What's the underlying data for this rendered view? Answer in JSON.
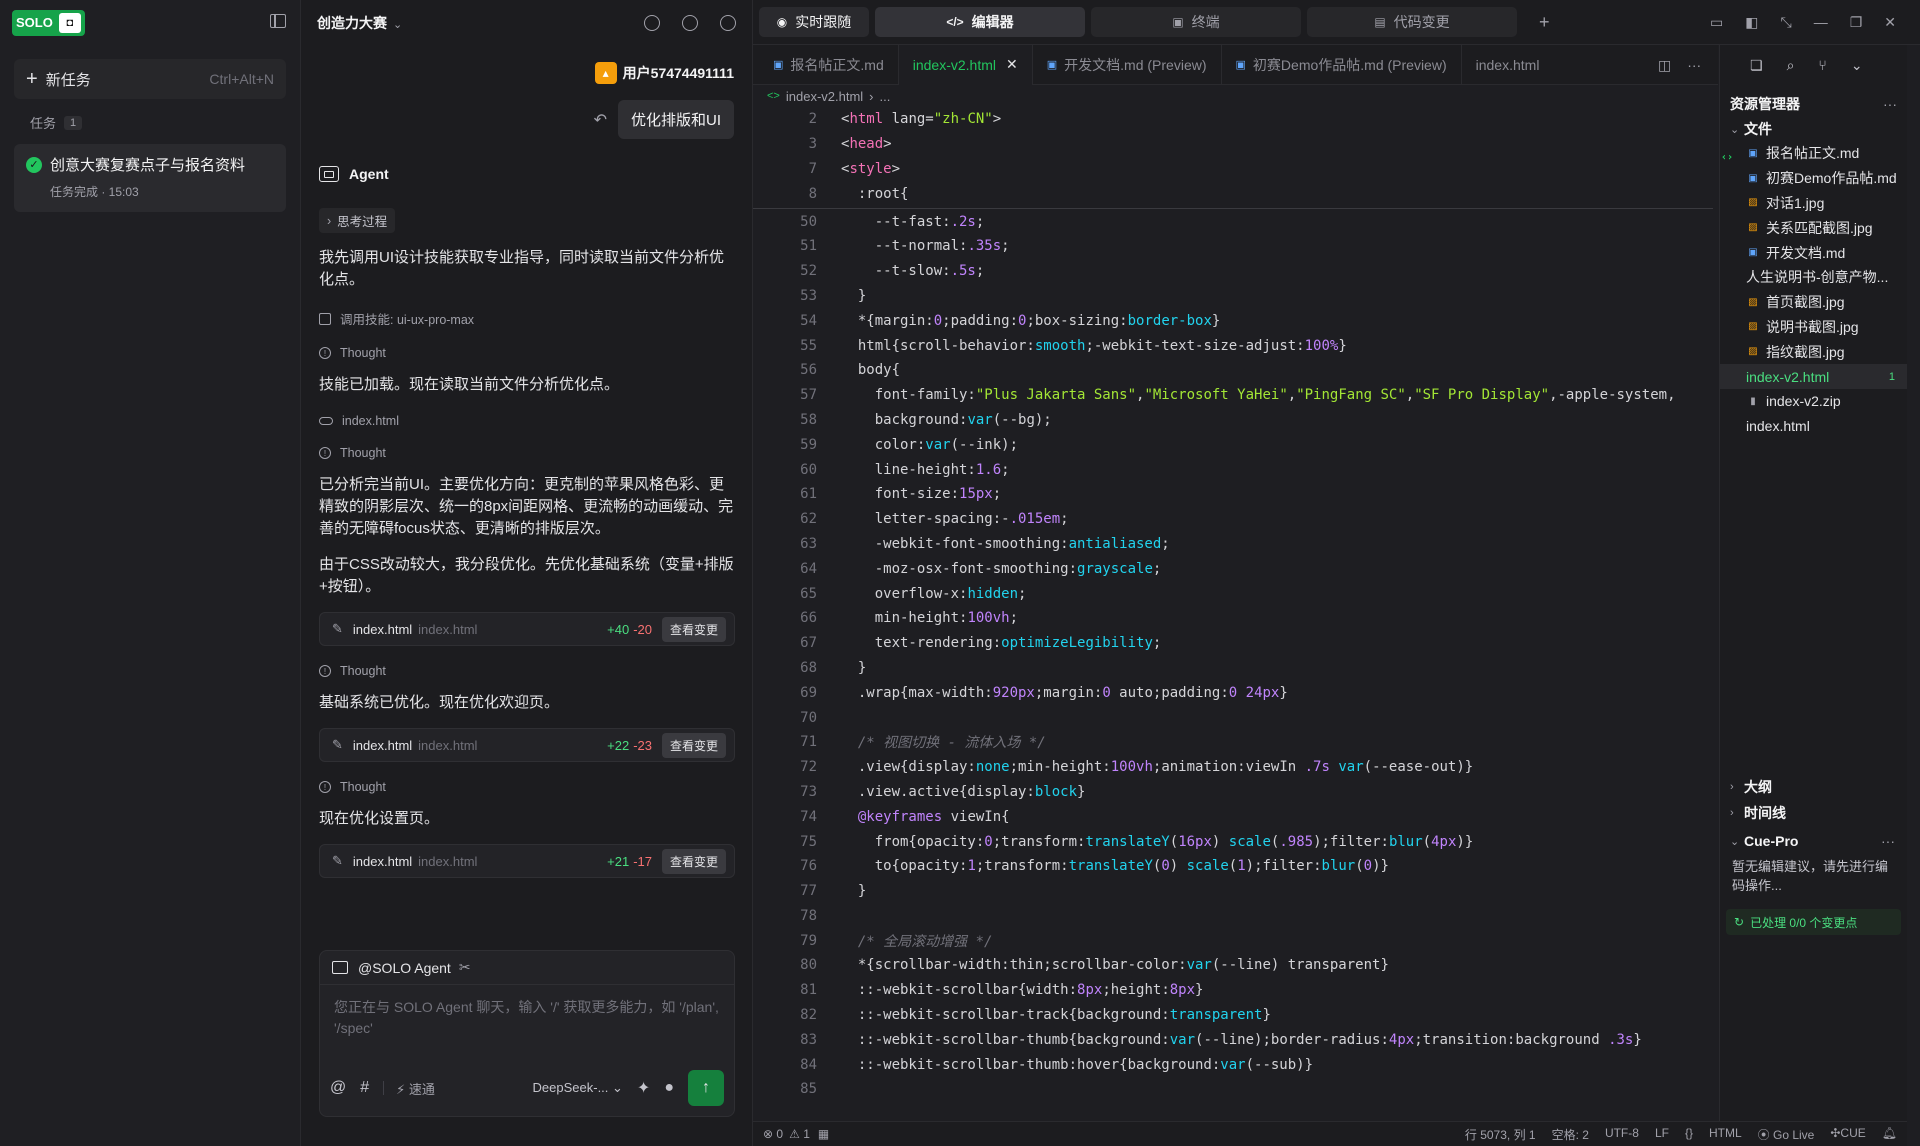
{
  "tasks": {
    "logo_text": "SOLO",
    "new_task_label": "新任务",
    "new_task_shortcut": "Ctrl+Alt+N",
    "section_label": "任务",
    "section_count": "1",
    "items": [
      {
        "title": "创意大赛复赛点子与报名资料",
        "subtitle": "任务完成 · 15:03"
      }
    ]
  },
  "chat": {
    "title": "创造力大赛",
    "user_name": "用户57474491111",
    "user_message": "优化排版和UI",
    "agent_name": "Agent",
    "thinking_pill": "思考过程",
    "thought_label": "Thought",
    "skill_call": "调用技能: ui-ux-pro-max",
    "read_file": "index.html",
    "messages": [
      "我先调用UI设计技能获取专业指导，同时读取当前文件分析优化点。",
      "技能已加载。现在读取当前文件分析优化点。",
      "已分析完当前UI。主要优化方向：更克制的苹果风格色彩、更精致的阴影层次、统一的8px间距网格、更流畅的动画缓动、完善的无障碍focus状态、更清晰的排版层次。",
      "由于CSS改动较大，我分段优化。先优化基础系统（变量+排版+按钮）。",
      "基础系统已优化。现在优化欢迎页。",
      "现在优化设置页。"
    ],
    "diffs": [
      {
        "file": "index.html",
        "path": "index.html",
        "added": "+40",
        "removed": "-20",
        "button": "查看变更"
      },
      {
        "file": "index.html",
        "path": "index.html",
        "added": "+22",
        "removed": "-23",
        "button": "查看变更"
      },
      {
        "file": "index.html",
        "path": "index.html",
        "added": "+21",
        "removed": "-17",
        "button": "查看变更"
      }
    ],
    "compose": {
      "agent_label": "@SOLO Agent",
      "placeholder": "您正在与 SOLO Agent 聊天，输入 '/' 获取更多能力，如 '/plan', '/spec'",
      "speed_label": "速通",
      "model": "DeepSeek-..."
    }
  },
  "editor": {
    "modes": [
      "实时跟随",
      "编辑器",
      "终端",
      "代码变更"
    ],
    "tabs": [
      {
        "label": "报名帖正文.md",
        "type": "md",
        "active": false
      },
      {
        "label": "index-v2.html",
        "type": "html",
        "active": true
      },
      {
        "label": "开发文档.md (Preview)",
        "type": "md",
        "active": false
      },
      {
        "label": "初赛Demo作品帖.md (Preview)",
        "type": "md",
        "active": false
      },
      {
        "label": "index.html",
        "type": "html",
        "active": false
      }
    ],
    "breadcrumb": "index-v2.html",
    "breadcrumb_more": "...",
    "sticky_lines": [
      {
        "num": "2",
        "code": "<html lang=\"zh-CN\">"
      },
      {
        "num": "3",
        "code": "<head>"
      },
      {
        "num": "7",
        "code": "<style>"
      },
      {
        "num": "8",
        "code": "  :root{"
      }
    ],
    "lines": [
      {
        "num": "50",
        "code": "    --t-fast:.2s;"
      },
      {
        "num": "51",
        "code": "    --t-normal:.35s;"
      },
      {
        "num": "52",
        "code": "    --t-slow:.5s;"
      },
      {
        "num": "53",
        "code": "  }"
      },
      {
        "num": "54",
        "code": "  *{margin:0;padding:0;box-sizing:border-box}"
      },
      {
        "num": "55",
        "code": "  html{scroll-behavior:smooth;-webkit-text-size-adjust:100%}"
      },
      {
        "num": "56",
        "code": "  body{"
      },
      {
        "num": "57",
        "code": "    font-family:\"Plus Jakarta Sans\",\"Microsoft YaHei\",\"PingFang SC\",\"SF Pro Display\",-apple-system,"
      },
      {
        "num": "58",
        "code": "    background:var(--bg);"
      },
      {
        "num": "59",
        "code": "    color:var(--ink);"
      },
      {
        "num": "60",
        "code": "    line-height:1.6;"
      },
      {
        "num": "61",
        "code": "    font-size:15px;"
      },
      {
        "num": "62",
        "code": "    letter-spacing:-.015em;"
      },
      {
        "num": "63",
        "code": "    -webkit-font-smoothing:antialiased;"
      },
      {
        "num": "64",
        "code": "    -moz-osx-font-smoothing:grayscale;"
      },
      {
        "num": "65",
        "code": "    overflow-x:hidden;"
      },
      {
        "num": "66",
        "code": "    min-height:100vh;"
      },
      {
        "num": "67",
        "code": "    text-rendering:optimizeLegibility;"
      },
      {
        "num": "68",
        "code": "  }"
      },
      {
        "num": "69",
        "code": "  .wrap{max-width:920px;margin:0 auto;padding:0 24px}"
      },
      {
        "num": "70",
        "code": ""
      },
      {
        "num": "71",
        "code": "  /* 视图切换 - 流体入场 */"
      },
      {
        "num": "72",
        "code": "  .view{display:none;min-height:100vh;animation:viewIn .7s var(--ease-out)}"
      },
      {
        "num": "73",
        "code": "  .view.active{display:block}"
      },
      {
        "num": "74",
        "code": "  @keyframes viewIn{"
      },
      {
        "num": "75",
        "code": "    from{opacity:0;transform:translateY(16px) scale(.985);filter:blur(4px)}"
      },
      {
        "num": "76",
        "code": "    to{opacity:1;transform:translateY(0) scale(1);filter:blur(0)}"
      },
      {
        "num": "77",
        "code": "  }"
      },
      {
        "num": "78",
        "code": ""
      },
      {
        "num": "79",
        "code": "  /* 全局滚动增强 */"
      },
      {
        "num": "80",
        "code": "  *{scrollbar-width:thin;scrollbar-color:var(--line) transparent}"
      },
      {
        "num": "81",
        "code": "  ::-webkit-scrollbar{width:8px;height:8px}"
      },
      {
        "num": "82",
        "code": "  ::-webkit-scrollbar-track{background:transparent}"
      },
      {
        "num": "83",
        "code": "  ::-webkit-scrollbar-thumb{background:var(--line);border-radius:4px;transition:background .3s}"
      },
      {
        "num": "84",
        "code": "  ::-webkit-scrollbar-thumb:hover{background:var(--sub)}"
      },
      {
        "num": "85",
        "code": ""
      }
    ]
  },
  "explorer": {
    "title": "资源管理器",
    "folder": "文件",
    "files": [
      {
        "name": "报名帖正文.md",
        "type": "md"
      },
      {
        "name": "初赛Demo作品帖.md",
        "type": "md"
      },
      {
        "name": "对话1.jpg",
        "type": "img"
      },
      {
        "name": "关系匹配截图.jpg",
        "type": "img"
      },
      {
        "name": "开发文档.md",
        "type": "md"
      },
      {
        "name": "人生说明书-创意产物...",
        "type": "code"
      },
      {
        "name": "首页截图.jpg",
        "type": "img"
      },
      {
        "name": "说明书截图.jpg",
        "type": "img"
      },
      {
        "name": "指纹截图.jpg",
        "type": "img"
      },
      {
        "name": "index-v2.html",
        "type": "code",
        "selected": true,
        "badge": "1"
      },
      {
        "name": "index-v2.zip",
        "type": "zip"
      },
      {
        "name": "index.html",
        "type": "code"
      }
    ],
    "outline": "大纲",
    "timeline": "时间线",
    "cue_title": "Cue-Pro",
    "cue_text": "暂无编辑建议，请先进行编码操作...",
    "cue_status": "已处理 0/0 个变更点"
  },
  "status": {
    "errors": "0",
    "warnings": "1",
    "position": "行 5073, 列 1",
    "spaces": "空格: 2",
    "encoding": "UTF-8",
    "eol": "LF",
    "language": "HTML",
    "golive": "Go Live",
    "cue": "CUE"
  }
}
